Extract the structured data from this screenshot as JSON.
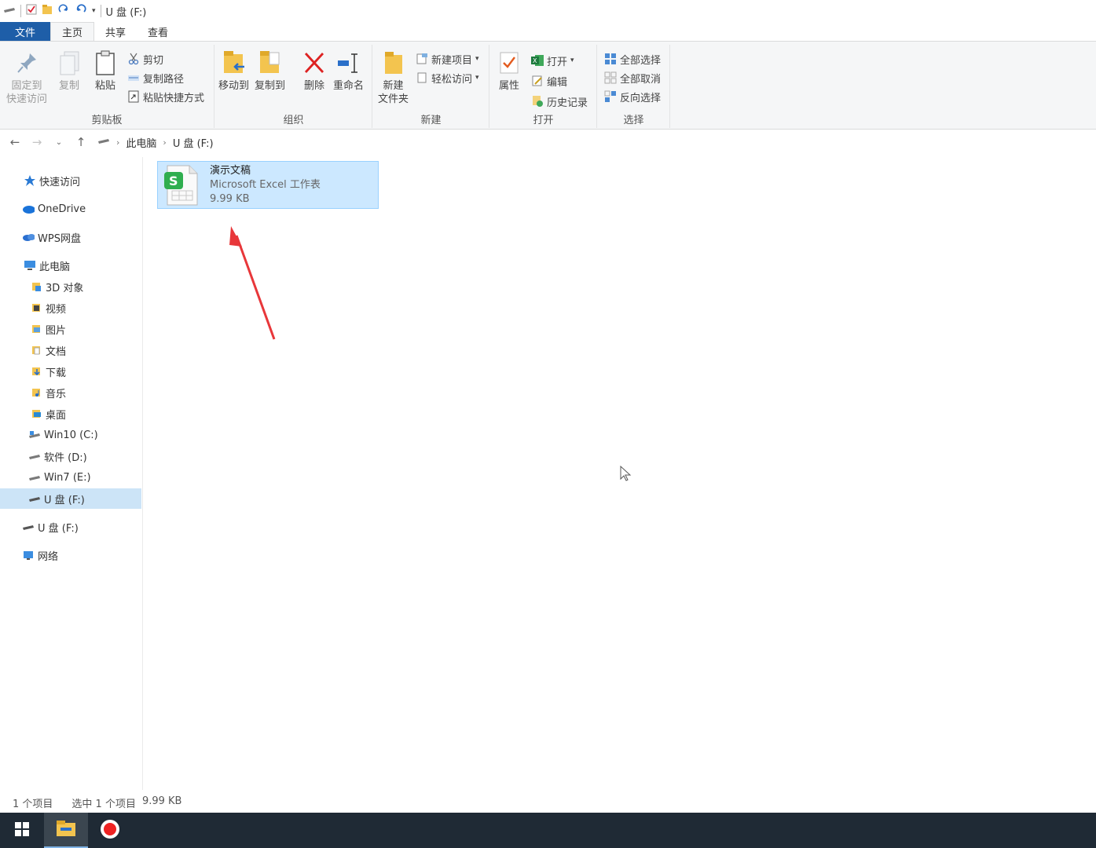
{
  "window": {
    "title": "U 盘 (F:)"
  },
  "tabs": [
    "文件",
    "主页",
    "共享",
    "查看"
  ],
  "ribbon": {
    "clipboard": {
      "label": "剪贴板",
      "pin_line1": "固定到",
      "pin_line2": "快速访问",
      "copy": "复制",
      "paste": "粘贴",
      "cut": "剪切",
      "copy_path": "复制路径",
      "paste_shortcut": "粘贴快捷方式"
    },
    "organize": {
      "label": "组织",
      "move_to": "移动到",
      "copy_to": "复制到",
      "delete": "删除",
      "rename": "重命名"
    },
    "new": {
      "label": "新建",
      "new_folder_line1": "新建",
      "new_folder_line2": "文件夹",
      "new_item": "新建项目",
      "easy_access": "轻松访问"
    },
    "open": {
      "label": "打开",
      "properties": "属性",
      "open": "打开",
      "edit": "编辑",
      "history": "历史记录"
    },
    "select": {
      "label": "选择",
      "select_all": "全部选择",
      "select_none": "全部取消",
      "invert": "反向选择"
    }
  },
  "address": {
    "crumbs": [
      "此电脑",
      "U 盘 (F:)"
    ]
  },
  "sidebar": {
    "items": [
      {
        "label": "快速访问",
        "icon": "star-icon"
      },
      {
        "label": "OneDrive",
        "icon": "cloud-icon"
      },
      {
        "label": "WPS网盘",
        "icon": "cloud-icon"
      },
      {
        "label": "此电脑",
        "icon": "computer-icon"
      },
      {
        "label": "3D 对象",
        "icon": "cube-icon"
      },
      {
        "label": "视频",
        "icon": "video-icon"
      },
      {
        "label": "图片",
        "icon": "picture-icon"
      },
      {
        "label": "文档",
        "icon": "document-icon"
      },
      {
        "label": "下载",
        "icon": "download-icon"
      },
      {
        "label": "音乐",
        "icon": "music-icon"
      },
      {
        "label": "桌面",
        "icon": "desktop-icon"
      },
      {
        "label": "Win10 (C:)",
        "icon": "drive-icon"
      },
      {
        "label": "软件 (D:)",
        "icon": "drive-icon"
      },
      {
        "label": "Win7 (E:)",
        "icon": "drive-icon"
      },
      {
        "label": "U 盘 (F:)",
        "icon": "usb-drive-icon"
      },
      {
        "label": "U 盘 (F:)",
        "icon": "usb-drive-icon"
      },
      {
        "label": "网络",
        "icon": "network-icon"
      }
    ]
  },
  "file": {
    "name": "演示文稿",
    "type": "Microsoft Excel 工作表",
    "size": "9.99 KB"
  },
  "status": {
    "count": "1 个项目",
    "selected": "选中 1 个项目",
    "selected_size": "9.99 KB"
  },
  "colors": {
    "accent": "#1e5ea8",
    "selection": "#cce8ff",
    "arrow": "#e8373a",
    "taskbar": "#1f2a35"
  }
}
